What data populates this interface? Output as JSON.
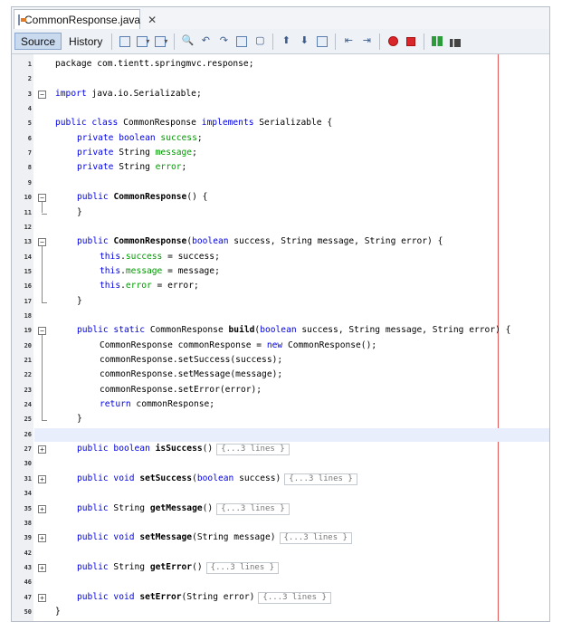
{
  "tab": {
    "title": "CommonResponse.java",
    "close": "✕"
  },
  "toolbar": {
    "source_label": "Source",
    "history_label": "History",
    "icons": [
      "last-edit-icon",
      "back-icon",
      "forward-icon",
      "find-icon",
      "find-prev-icon",
      "find-next-icon",
      "toggle-highlight-icon",
      "toggle-rect-select-icon",
      "prev-bookmark-icon",
      "next-bookmark-icon",
      "toggle-bookmark-icon",
      "shift-left-icon",
      "shift-right-icon",
      "start-macro-icon",
      "stop-macro-icon",
      "comment-icon",
      "uncomment-icon"
    ]
  },
  "lines": [
    {
      "n": "1",
      "indent": 1,
      "code": [
        {
          "t": "package com.tientt.springmvc.response;"
        }
      ]
    },
    {
      "n": "2",
      "indent": 0,
      "code": []
    },
    {
      "n": "3",
      "indent": 1,
      "fold": "minus",
      "code": [
        {
          "t": "import",
          "k": "kw"
        },
        {
          "t": " java.io.Serializable;"
        }
      ]
    },
    {
      "n": "4",
      "indent": 0,
      "code": []
    },
    {
      "n": "5",
      "indent": 1,
      "code": [
        {
          "t": "public class",
          "k": "kw"
        },
        {
          "t": " CommonResponse "
        },
        {
          "t": "implements",
          "k": "kw"
        },
        {
          "t": " Serializable {"
        }
      ]
    },
    {
      "n": "6",
      "indent": 2,
      "code": [
        {
          "t": "private boolean",
          "k": "kw"
        },
        {
          "t": " "
        },
        {
          "t": "success",
          "k": "fld"
        },
        {
          "t": ";"
        }
      ]
    },
    {
      "n": "7",
      "indent": 2,
      "code": [
        {
          "t": "private",
          "k": "kw"
        },
        {
          "t": " String "
        },
        {
          "t": "message",
          "k": "fld"
        },
        {
          "t": ";"
        }
      ]
    },
    {
      "n": "8",
      "indent": 2,
      "code": [
        {
          "t": "private",
          "k": "kw"
        },
        {
          "t": " String "
        },
        {
          "t": "error",
          "k": "fld"
        },
        {
          "t": ";"
        }
      ]
    },
    {
      "n": "9",
      "indent": 0,
      "code": []
    },
    {
      "n": "10",
      "indent": 2,
      "fold": "minus",
      "code": [
        {
          "t": "public",
          "k": "kw"
        },
        {
          "t": " "
        },
        {
          "t": "CommonResponse",
          "k": "meth"
        },
        {
          "t": "() {"
        }
      ]
    },
    {
      "n": "11",
      "indent": 2,
      "foldend": true,
      "code": [
        {
          "t": "}"
        }
      ]
    },
    {
      "n": "12",
      "indent": 0,
      "code": []
    },
    {
      "n": "13",
      "indent": 2,
      "fold": "minus",
      "code": [
        {
          "t": "public",
          "k": "kw"
        },
        {
          "t": " "
        },
        {
          "t": "CommonResponse",
          "k": "meth"
        },
        {
          "t": "("
        },
        {
          "t": "boolean",
          "k": "kw"
        },
        {
          "t": " success, String message, String error) {"
        }
      ]
    },
    {
      "n": "14",
      "indent": 3,
      "code": [
        {
          "t": "this",
          "k": "kw"
        },
        {
          "t": "."
        },
        {
          "t": "success",
          "k": "fld"
        },
        {
          "t": " = success;"
        }
      ]
    },
    {
      "n": "15",
      "indent": 3,
      "code": [
        {
          "t": "this",
          "k": "kw"
        },
        {
          "t": "."
        },
        {
          "t": "message",
          "k": "fld"
        },
        {
          "t": " = message;"
        }
      ]
    },
    {
      "n": "16",
      "indent": 3,
      "code": [
        {
          "t": "this",
          "k": "kw"
        },
        {
          "t": "."
        },
        {
          "t": "error",
          "k": "fld"
        },
        {
          "t": " = error;"
        }
      ]
    },
    {
      "n": "17",
      "indent": 2,
      "foldend": true,
      "code": [
        {
          "t": "}"
        }
      ]
    },
    {
      "n": "18",
      "indent": 0,
      "code": []
    },
    {
      "n": "19",
      "indent": 2,
      "fold": "minus",
      "code": [
        {
          "t": "public static",
          "k": "kw"
        },
        {
          "t": " CommonResponse "
        },
        {
          "t": "build",
          "k": "meth"
        },
        {
          "t": "("
        },
        {
          "t": "boolean",
          "k": "kw"
        },
        {
          "t": " success, String message, String error) {"
        }
      ]
    },
    {
      "n": "20",
      "indent": 3,
      "code": [
        {
          "t": "CommonResponse commonResponse = "
        },
        {
          "t": "new",
          "k": "kw"
        },
        {
          "t": " CommonResponse();"
        }
      ]
    },
    {
      "n": "21",
      "indent": 3,
      "code": [
        {
          "t": "commonResponse.setSuccess(success);"
        }
      ]
    },
    {
      "n": "22",
      "indent": 3,
      "code": [
        {
          "t": "commonResponse.setMessage(message);"
        }
      ]
    },
    {
      "n": "23",
      "indent": 3,
      "code": [
        {
          "t": "commonResponse.setError(error);"
        }
      ]
    },
    {
      "n": "24",
      "indent": 3,
      "code": [
        {
          "t": "return",
          "k": "kw"
        },
        {
          "t": " commonResponse;"
        }
      ]
    },
    {
      "n": "25",
      "indent": 2,
      "foldend": true,
      "code": [
        {
          "t": "}"
        }
      ]
    },
    {
      "n": "26",
      "indent": 0,
      "highlight": true,
      "code": []
    },
    {
      "n": "27",
      "indent": 2,
      "fold": "plus",
      "code": [
        {
          "t": "public boolean",
          "k": "kw"
        },
        {
          "t": " "
        },
        {
          "t": "isSuccess",
          "k": "meth"
        },
        {
          "t": "()"
        },
        {
          "t": "{...3 lines }",
          "k": "cf"
        }
      ]
    },
    {
      "n": "30",
      "indent": 0,
      "code": []
    },
    {
      "n": "31",
      "indent": 2,
      "fold": "plus",
      "code": [
        {
          "t": "public void",
          "k": "kw"
        },
        {
          "t": " "
        },
        {
          "t": "setSuccess",
          "k": "meth"
        },
        {
          "t": "("
        },
        {
          "t": "boolean",
          "k": "kw"
        },
        {
          "t": " success)"
        },
        {
          "t": "{...3 lines }",
          "k": "cf"
        }
      ]
    },
    {
      "n": "34",
      "indent": 0,
      "code": []
    },
    {
      "n": "35",
      "indent": 2,
      "fold": "plus",
      "code": [
        {
          "t": "public",
          "k": "kw"
        },
        {
          "t": " String "
        },
        {
          "t": "getMessage",
          "k": "meth"
        },
        {
          "t": "()"
        },
        {
          "t": "{...3 lines }",
          "k": "cf"
        }
      ]
    },
    {
      "n": "38",
      "indent": 0,
      "code": []
    },
    {
      "n": "39",
      "indent": 2,
      "fold": "plus",
      "code": [
        {
          "t": "public void",
          "k": "kw"
        },
        {
          "t": " "
        },
        {
          "t": "setMessage",
          "k": "meth"
        },
        {
          "t": "(String message)"
        },
        {
          "t": "{...3 lines }",
          "k": "cf"
        }
      ]
    },
    {
      "n": "42",
      "indent": 0,
      "code": []
    },
    {
      "n": "43",
      "indent": 2,
      "fold": "plus",
      "code": [
        {
          "t": "public",
          "k": "kw"
        },
        {
          "t": " String "
        },
        {
          "t": "getError",
          "k": "meth"
        },
        {
          "t": "()"
        },
        {
          "t": "{...3 lines }",
          "k": "cf"
        }
      ]
    },
    {
      "n": "46",
      "indent": 0,
      "code": []
    },
    {
      "n": "47",
      "indent": 2,
      "fold": "plus",
      "code": [
        {
          "t": "public void",
          "k": "kw"
        },
        {
          "t": " "
        },
        {
          "t": "setError",
          "k": "meth"
        },
        {
          "t": "(String error)"
        },
        {
          "t": "{...3 lines }",
          "k": "cf"
        }
      ]
    },
    {
      "n": "50",
      "indent": 1,
      "code": [
        {
          "t": "}"
        }
      ]
    }
  ]
}
